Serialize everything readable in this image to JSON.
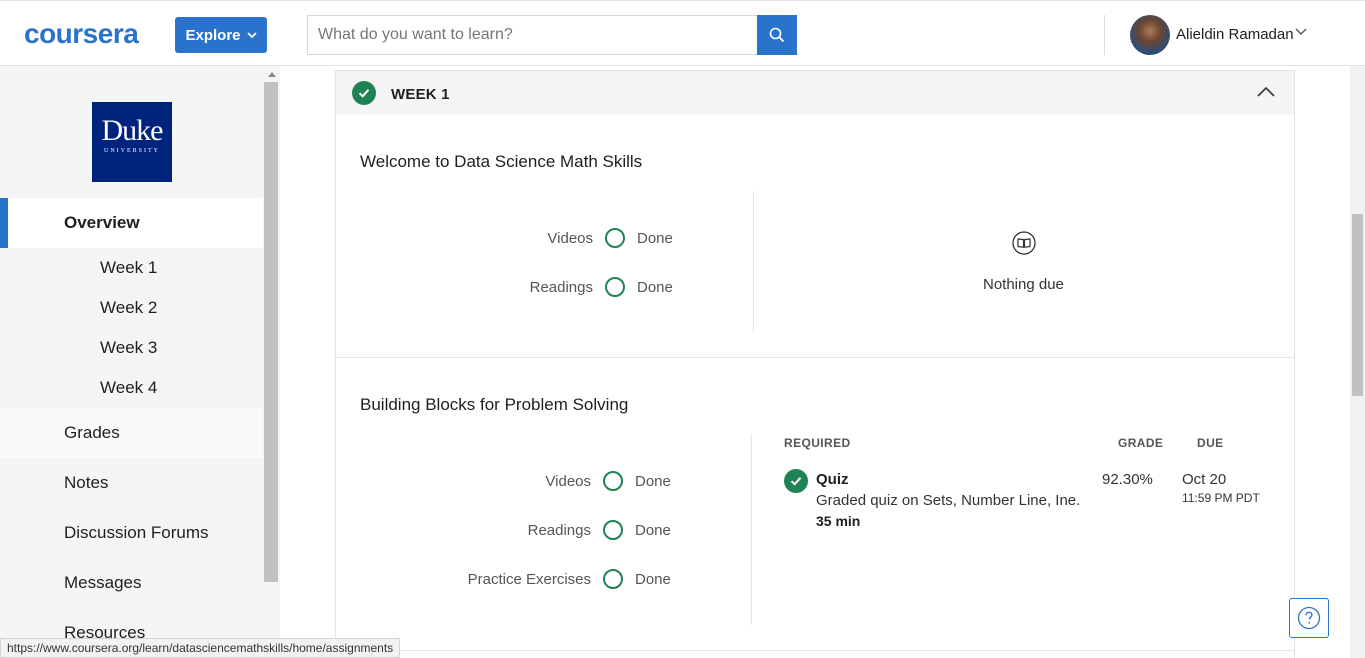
{
  "header": {
    "logo": "coursera",
    "explore_label": "Explore",
    "search_placeholder": "What do you want to learn?",
    "user_name": "Alieldin Ramadan"
  },
  "sidebar": {
    "university_logo_line1": "Duke",
    "university_logo_line2": "UNIVERSITY",
    "items": [
      {
        "label": "Overview"
      },
      {
        "label": "Week 1"
      },
      {
        "label": "Week 2"
      },
      {
        "label": "Week 3"
      },
      {
        "label": "Week 4"
      },
      {
        "label": "Grades"
      },
      {
        "label": "Notes"
      },
      {
        "label": "Discussion Forums"
      },
      {
        "label": "Messages"
      },
      {
        "label": "Resources"
      }
    ]
  },
  "week": {
    "title": "WEEK 1",
    "sections": [
      {
        "title": "Welcome to Data Science Math Skills",
        "rows": [
          {
            "label": "Videos",
            "status": "Done"
          },
          {
            "label": "Readings",
            "status": "Done"
          }
        ],
        "nothing_due": "Nothing due"
      },
      {
        "title": "Building Blocks for Problem Solving",
        "rows": [
          {
            "label": "Videos",
            "status": "Done"
          },
          {
            "label": "Readings",
            "status": "Done"
          },
          {
            "label": "Practice Exercises",
            "status": "Done"
          }
        ],
        "table_headers": {
          "required": "REQUIRED",
          "grade": "GRADE",
          "due": "DUE"
        },
        "assignment": {
          "title": "Quiz",
          "description": "Graded quiz on Sets, Number Line, Ine...",
          "duration": "35 min",
          "grade": "92.30%",
          "due_date": "Oct 20",
          "due_time": "11:59 PM PDT"
        }
      }
    ]
  },
  "status_bar": {
    "url": "https://www.coursera.org/learn/datasciencemathskills/home/assignments"
  },
  "colors": {
    "brand_blue": "#2a73cc",
    "success_green": "#1f8354",
    "duke_blue": "#00247d"
  }
}
